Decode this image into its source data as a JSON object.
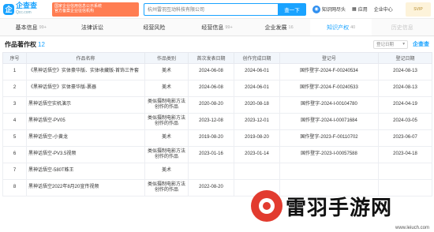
{
  "header": {
    "logo_mark": "企",
    "logo_text": "企查查",
    "logo_sub": "Qcc.com",
    "promo_line1": "国家企业信用信息公示系统",
    "promo_line2": "官方备案企业征信机构",
    "search_value": "杭州雷羽互动科技有限公司",
    "search_button": "查一下",
    "link1": "知识网尽头",
    "link2": "应用",
    "link3": "企业中心",
    "vip": "SVIP"
  },
  "tabs": [
    {
      "label": "基本信息",
      "count": "99+"
    },
    {
      "label": "法律诉讼",
      "count": ""
    },
    {
      "label": "经营风险",
      "count": ""
    },
    {
      "label": "经营信息",
      "count": "99+"
    },
    {
      "label": "企业发展",
      "count": "16"
    },
    {
      "label": "知识产权",
      "count": "40"
    },
    {
      "label": "历史信息",
      "count": ""
    }
  ],
  "section": {
    "title": "作品著作权",
    "count": "12",
    "filter": "登记日期",
    "brand": "企查查"
  },
  "table": {
    "columns": [
      "序号",
      "作品名称",
      "作品类别",
      "首次发表日期",
      "创作完成日期",
      "登记号",
      "登记日期"
    ],
    "rows": [
      [
        "1",
        "《黑神话悟空》实体豪华版、实体收藏版-首饰三件套",
        "美术",
        "2024-06-08",
        "2024-06-01",
        "国作登字-2024-F-00240534",
        "2024-08-13"
      ],
      [
        "2",
        "《黑神话悟空》实体豪华版-裹器",
        "美术",
        "2024-06-08",
        "2024-06-01",
        "国作登字-2024-F-00240533",
        "2024-08-13"
      ],
      [
        "3",
        "黑神话悟空实机演示",
        "类似摄制电影方法创作的作品",
        "2020-08-20",
        "2020-08-18",
        "国作登字-2024-I-00104780",
        "2024-04-19"
      ],
      [
        "4",
        "黑神话悟空-PV05",
        "类似摄制电影方法创作的作品",
        "2023-12-08",
        "2023-12-01",
        "国作登字-2024-I-00071684",
        "2024-03-05"
      ],
      [
        "5",
        "黑神话悟空-小黄龙",
        "美术",
        "2019-08-20",
        "2019-08-20",
        "国作登字-2023-F-00110702",
        "2023-06-07"
      ],
      [
        "6",
        "黑神话悟空-PV3.5视频",
        "类似摄制电影方法创作的作品",
        "2023-01-16",
        "2023-01-14",
        "国作登字-2023-I-00057588",
        "2023-04-18"
      ],
      [
        "7",
        "黑神话悟空-580T蛛王",
        "美术",
        "",
        "",
        "",
        ""
      ],
      [
        "8",
        "黑神话悟空2022年8月20宣传视频",
        "类似摄制电影方法创作的作品",
        "2022-08-20",
        "",
        "",
        ""
      ]
    ]
  },
  "watermark": {
    "text": "雷羽手游网",
    "url": "www.leiuch.com"
  }
}
